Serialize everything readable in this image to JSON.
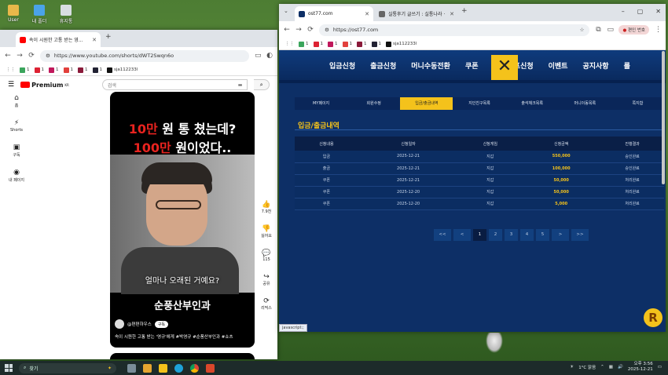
{
  "desktop": {
    "icons": [
      {
        "label": "User",
        "color": "#e8b84a"
      },
      {
        "label": "내 폴더",
        "color": "#4aa3e8"
      },
      {
        "label": "휴지통",
        "color": "#d8dde2"
      }
    ]
  },
  "youtube_window": {
    "tab_title": "속이 시원한 고통 받는 영...",
    "url": "https://www.youtube.com/shorts/dWT2Swqn6o",
    "bookmarks": [
      "1",
      "1",
      "1",
      "1",
      "1",
      "1",
      "sja112233l"
    ],
    "logo_text": "Premium",
    "logo_sup": "KR",
    "search_placeholder": "검색",
    "side_nav": [
      {
        "icon": "⌂",
        "label": "홈"
      },
      {
        "icon": "⚡",
        "label": "Shorts"
      },
      {
        "icon": "▣",
        "label": "구독"
      },
      {
        "icon": "◉",
        "label": "내 페이지"
      }
    ],
    "short": {
      "title_line1_red": "10만",
      "title_line1_white": " 원 통 쳤는데?",
      "title_line2_red": "100만",
      "title_line2_white": " 원이었다..",
      "subtitle": "얼마나 오래된 거예요?",
      "caption": "순풍산부인과",
      "channel": "@편편하우스",
      "subscribe": "구독",
      "description": "속이 시원한 고통 받는 '영규'에게 #박영규 #순풍산부인과 #쇼츠"
    },
    "actions": [
      {
        "icon": "👍",
        "label": "7.9천"
      },
      {
        "icon": "👎",
        "label": "싫어요"
      },
      {
        "icon": "💬",
        "label": "115"
      },
      {
        "icon": "↪",
        "label": "공유"
      },
      {
        "icon": "⟳",
        "label": "리믹스"
      }
    ]
  },
  "site_window": {
    "tabs": [
      {
        "title": "ost77.com"
      },
      {
        "title": "실통후기 글쓰기 : 실통나라 ·"
      }
    ],
    "url": "https://ost77.com",
    "bookmarks": [
      "1",
      "1",
      "1",
      "1",
      "1",
      "1",
      "sja112233l"
    ],
    "profile": "편인 번호",
    "menu": [
      "입금신청",
      "출금신청",
      "머니수동전환",
      "쿠폰",
      "콤프신청",
      "이벤트",
      "공지사항",
      "룰"
    ],
    "sub_tabs": [
      "MY페이지",
      "회원수정",
      "입금/출금내역",
      "지인친구목록",
      "출석체크목록",
      "머니이동목록",
      "쪽지함"
    ],
    "active_sub_tab": 2,
    "section_title": "입금/출금내역",
    "table": {
      "headers": [
        "신청내용",
        "신청일자",
        "신청게임",
        "신청금액",
        "진행결과"
      ],
      "rows": [
        [
          "입금",
          "2025-12-21",
          "지갑",
          "550,000",
          "승인완료"
        ],
        [
          "출금",
          "2025-12-21",
          "지갑",
          "100,000",
          "승인완료"
        ],
        [
          "쿠폰",
          "2025-12-21",
          "지갑",
          "50,000",
          "처리완료"
        ],
        [
          "쿠폰",
          "2025-12-20",
          "지갑",
          "50,000",
          "처리완료"
        ],
        [
          "쿠폰",
          "2025-12-20",
          "지갑",
          "5,000",
          "처리완료"
        ]
      ]
    },
    "pager": [
      "<<",
      "<",
      "1",
      "2",
      "3",
      "4",
      "5",
      ">",
      ">>"
    ],
    "active_page": "1",
    "status_tip": "javascript:;",
    "accent": "#f4c21b"
  },
  "taskbar": {
    "search": "찾기",
    "weather": "1°C 맑음",
    "time": "오후 3:56",
    "date": "2025-12-21"
  }
}
